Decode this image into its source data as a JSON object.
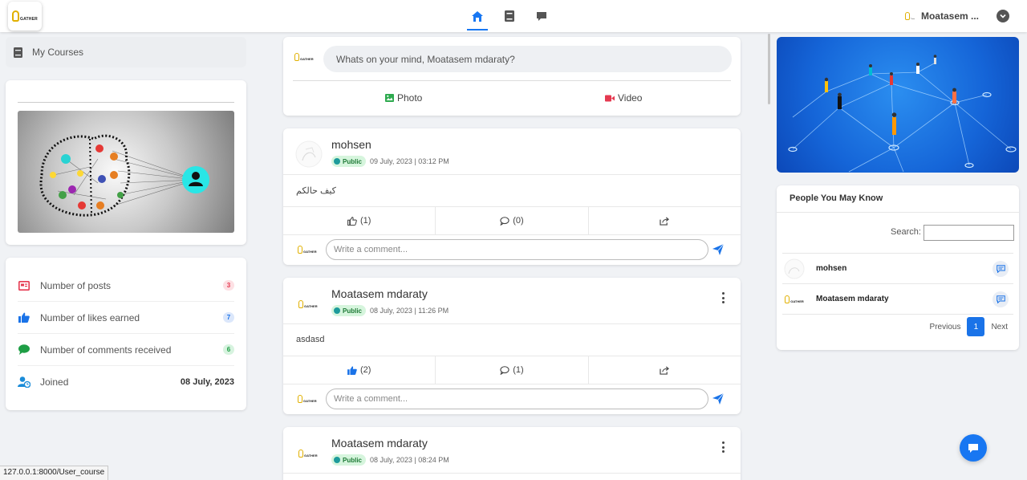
{
  "logo": {
    "text": "GATHER"
  },
  "user": {
    "name": "Moatasem ..."
  },
  "sidebar": {
    "my_courses": "My Courses",
    "stats": [
      {
        "label": "Number of posts",
        "value": "3",
        "color": "#e53950",
        "bg": "#fde0e4",
        "icon": "newspaper-icon"
      },
      {
        "label": "Number of likes earned",
        "value": "7",
        "color": "#1a73e8",
        "bg": "#dbe7fb",
        "icon": "thumbs-up-icon"
      },
      {
        "label": "Number of comments received",
        "value": "6",
        "color": "#1e9e45",
        "bg": "#d7f3df",
        "icon": "comment-icon"
      },
      {
        "label": "Joined",
        "value": "08 July, 2023",
        "color": "#1a8bd8",
        "icon": "user-clock-icon"
      }
    ]
  },
  "composer": {
    "placeholder": "Whats on your mind, Moatasem mdaraty?",
    "photo_label": "Photo",
    "video_label": "Video"
  },
  "posts": [
    {
      "author": "mohsen",
      "visibility": "Public",
      "date": "09 July, 2023 | 03:12 PM",
      "body": "كيف حالكم",
      "likes": "(1)",
      "comments": "(0)",
      "liked": false
    },
    {
      "author": "Moatasem mdaraty",
      "visibility": "Public",
      "date": "08 July, 2023 | 11:26 PM",
      "body": "asdasd",
      "likes": "(2)",
      "comments": "(1)",
      "liked": true
    },
    {
      "author": "Moatasem mdaraty",
      "visibility": "Public",
      "date": "08 July, 2023 | 08:24 PM"
    }
  ],
  "comment_placeholder": "Write a comment...",
  "people": {
    "title": "People You May Know",
    "search_label": "Search:",
    "items": [
      {
        "name": "mohsen"
      },
      {
        "name": "Moatasem mdaraty"
      }
    ],
    "prev": "Previous",
    "page": "1",
    "next": "Next"
  },
  "status_url": "127.0.0.1:8000/User_course",
  "colors": {
    "accent": "#1877f2",
    "public_bg": "#d6f5dd",
    "brand_gold": "#e1b000"
  }
}
